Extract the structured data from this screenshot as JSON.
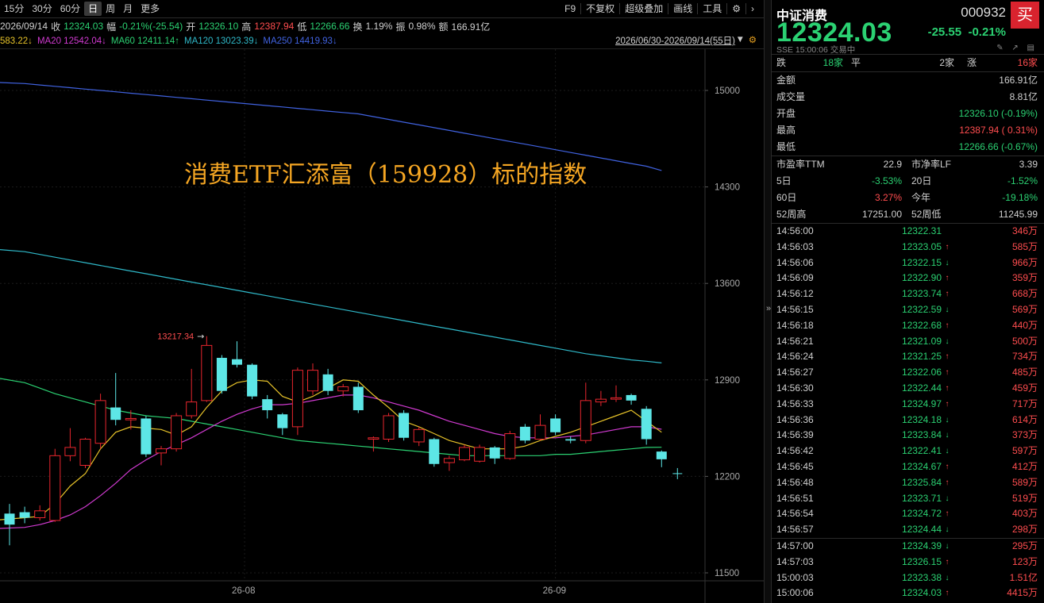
{
  "toolbar": {
    "periods": [
      "15分",
      "30分",
      "60分",
      "日",
      "周",
      "月",
      "更多"
    ],
    "active_period": "日",
    "tools": [
      "F9",
      "不复权",
      "超级叠加",
      "画线",
      "工具",
      "⚙",
      "›"
    ]
  },
  "info": {
    "date": "2026/09/14",
    "close_label": "收",
    "close": "12324.03",
    "amp_label": "幅",
    "amp": "-0.21%(-25.54)",
    "open_label": "开",
    "open": "12326.10",
    "high_label": "高",
    "high": "12387.94",
    "low_label": "低",
    "low": "12266.66",
    "turnover_label": "换",
    "turnover": "1.19%",
    "swing_label": "振",
    "swing": "0.98%",
    "amount_label": "额",
    "amount": "166.91亿"
  },
  "ma": {
    "ma_partial": "583.22↓",
    "ma20": "MA20 12542.04↓",
    "ma60": "MA60 12411.14↑",
    "ma120": "MA120 13023.39↓",
    "ma250": "MA250 14419.93↓",
    "range": "2026/06/30-2026/09/14(55日)",
    "colors": {
      "ma5": "#e6c229",
      "ma20": "#d03ad0",
      "ma60": "#2bd172",
      "ma120": "#2fb8c8",
      "ma250": "#4062e0"
    }
  },
  "chart_data": {
    "type": "candlestick",
    "title": "消费ETF汇添富（159928）标的指数",
    "y_ticks": [
      15000,
      14300,
      13600,
      12900,
      12200,
      11500
    ],
    "x_ticks": [
      "26-08",
      "26-09"
    ],
    "max_label": "13217.34",
    "candles": [
      {
        "o": 11930,
        "c": 11850,
        "h": 12000,
        "l": 11700
      },
      {
        "o": 11940,
        "c": 11900,
        "h": 11980,
        "l": 11860
      },
      {
        "o": 11900,
        "c": 11950,
        "h": 11990,
        "l": 11880
      },
      {
        "o": 11880,
        "c": 12350,
        "h": 12400,
        "l": 11870
      },
      {
        "o": 12350,
        "c": 12410,
        "h": 12550,
        "l": 12310
      },
      {
        "o": 12280,
        "c": 12470,
        "h": 12480,
        "l": 12260
      },
      {
        "o": 12440,
        "c": 12750,
        "h": 12800,
        "l": 12400
      },
      {
        "o": 12700,
        "c": 12610,
        "h": 12950,
        "l": 12570
      },
      {
        "o": 12610,
        "c": 12620,
        "h": 12680,
        "l": 12540
      },
      {
        "o": 12620,
        "c": 12360,
        "h": 12640,
        "l": 12340
      },
      {
        "o": 12370,
        "c": 12400,
        "h": 12420,
        "l": 12280
      },
      {
        "o": 12400,
        "c": 12640,
        "h": 12660,
        "l": 12380
      },
      {
        "o": 12640,
        "c": 12740,
        "h": 12980,
        "l": 12620
      },
      {
        "o": 12750,
        "c": 13150,
        "h": 13217.34,
        "l": 12740
      },
      {
        "o": 13060,
        "c": 12820,
        "h": 13080,
        "l": 12800
      },
      {
        "o": 13050,
        "c": 13010,
        "h": 13180,
        "l": 12990
      },
      {
        "o": 13010,
        "c": 12780,
        "h": 13020,
        "l": 12760
      },
      {
        "o": 12760,
        "c": 12680,
        "h": 12790,
        "l": 12620
      },
      {
        "o": 12650,
        "c": 12550,
        "h": 12660,
        "l": 12500
      },
      {
        "o": 12560,
        "c": 12970,
        "h": 12990,
        "l": 12500
      },
      {
        "o": 12820,
        "c": 12970,
        "h": 13020,
        "l": 12790
      },
      {
        "o": 12940,
        "c": 12820,
        "h": 12980,
        "l": 12790
      },
      {
        "o": 12820,
        "c": 12850,
        "h": 12870,
        "l": 12780
      },
      {
        "o": 12850,
        "c": 12680,
        "h": 12880,
        "l": 12660
      },
      {
        "o": 12470,
        "c": 12480,
        "h": 12490,
        "l": 12380
      },
      {
        "o": 12470,
        "c": 12640,
        "h": 12660,
        "l": 12450
      },
      {
        "o": 12660,
        "c": 12480,
        "h": 12680,
        "l": 12460
      },
      {
        "o": 12450,
        "c": 12540,
        "h": 12560,
        "l": 12420
      },
      {
        "o": 12470,
        "c": 12290,
        "h": 12480,
        "l": 12270
      },
      {
        "o": 12300,
        "c": 12330,
        "h": 12350,
        "l": 12240
      },
      {
        "o": 12320,
        "c": 12410,
        "h": 12430,
        "l": 12310
      },
      {
        "o": 12310,
        "c": 12410,
        "h": 12430,
        "l": 12300
      },
      {
        "o": 12410,
        "c": 12330,
        "h": 12420,
        "l": 12290
      },
      {
        "o": 12330,
        "c": 12510,
        "h": 12530,
        "l": 12320
      },
      {
        "o": 12560,
        "c": 12460,
        "h": 12580,
        "l": 12440
      },
      {
        "o": 12470,
        "c": 12570,
        "h": 12650,
        "l": 12460
      },
      {
        "o": 12620,
        "c": 12520,
        "h": 12650,
        "l": 12500
      },
      {
        "o": 12470,
        "c": 12460,
        "h": 12490,
        "l": 12440
      },
      {
        "o": 12460,
        "c": 12750,
        "h": 12880,
        "l": 12440
      },
      {
        "o": 12740,
        "c": 12760,
        "h": 12820,
        "l": 12710
      },
      {
        "o": 12760,
        "c": 12770,
        "h": 12860,
        "l": 12740
      },
      {
        "o": 12790,
        "c": 12750,
        "h": 12800,
        "l": 12720
      },
      {
        "o": 12690,
        "c": 12470,
        "h": 12710,
        "l": 12430
      },
      {
        "o": 12380,
        "c": 12324.03,
        "h": 12387.94,
        "l": 12266.66
      }
    ],
    "ma5": [
      11880,
      11900,
      11910,
      12000,
      12130,
      12220,
      12400,
      12520,
      12560,
      12550,
      12540,
      12500,
      12560,
      12700,
      12820,
      12880,
      12900,
      12890,
      12780,
      12740,
      12780,
      12840,
      12900,
      12890,
      12790,
      12700,
      12600,
      12560,
      12510,
      12460,
      12430,
      12400,
      12400,
      12400,
      12420,
      12460,
      12490,
      12520,
      12560,
      12600,
      12640,
      12680,
      12600,
      12520
    ],
    "ma20": [
      11820,
      11830,
      11850,
      11880,
      11920,
      11980,
      12060,
      12150,
      12250,
      12320,
      12380,
      12430,
      12480,
      12540,
      12600,
      12650,
      12690,
      12720,
      12720,
      12730,
      12750,
      12770,
      12790,
      12790,
      12770,
      12740,
      12710,
      12680,
      12640,
      12600,
      12570,
      12540,
      12510,
      12490,
      12480,
      12480,
      12480,
      12490,
      12500,
      12520,
      12540,
      12560,
      12560,
      12542
    ],
    "ma60": [
      12920,
      12880,
      12840,
      12800,
      12770,
      12740,
      12710,
      12680,
      12660,
      12640,
      12630,
      12620,
      12600,
      12580,
      12560,
      12540,
      12520,
      12500,
      12480,
      12460,
      12450,
      12440,
      12430,
      12420,
      12410,
      12400,
      12390,
      12380,
      12370,
      12360,
      12350,
      12350,
      12350,
      12350,
      12350,
      12350,
      12360,
      12360,
      12370,
      12380,
      12390,
      12400,
      12410,
      12411
    ],
    "ma120": [
      13850,
      13830,
      13810,
      13790,
      13770,
      13750,
      13730,
      13710,
      13690,
      13670,
      13650,
      13630,
      13610,
      13590,
      13570,
      13550,
      13530,
      13510,
      13490,
      13470,
      13450,
      13430,
      13410,
      13390,
      13370,
      13350,
      13330,
      13310,
      13290,
      13270,
      13250,
      13230,
      13210,
      13190,
      13170,
      13150,
      13130,
      13110,
      13090,
      13075,
      13060,
      13045,
      13035,
      13023
    ],
    "ma250": [
      15060,
      15050,
      15040,
      15030,
      15020,
      15010,
      15000,
      14990,
      14980,
      14970,
      14960,
      14950,
      14940,
      14930,
      14920,
      14910,
      14900,
      14890,
      14880,
      14870,
      14860,
      14850,
      14840,
      14830,
      14810,
      14790,
      14770,
      14750,
      14730,
      14710,
      14690,
      14670,
      14650,
      14630,
      14610,
      14590,
      14570,
      14550,
      14530,
      14510,
      14490,
      14470,
      14450,
      14419
    ]
  },
  "quote": {
    "name": "中证消费",
    "code": "000932",
    "buy": "买",
    "price": "12324.03",
    "change": "-25.55",
    "change_pct": "-0.21%",
    "sub": "SSE  15:00:06  交易中",
    "icons": "✎ ↗ ▤",
    "breadth": {
      "down_label": "跌",
      "down": "18家",
      "flat_label": "平",
      "flat": "2家",
      "up_label": "涨",
      "up": "16家"
    },
    "rows": [
      {
        "label": "金额",
        "value": "166.91亿",
        "cls": "w"
      },
      {
        "label": "成交量",
        "value": "8.81亿",
        "cls": "w"
      },
      {
        "label": "开盘",
        "value": "12326.10 (-0.19%)",
        "cls": "g"
      },
      {
        "label": "最高",
        "value": "12387.94 ( 0.31%)",
        "cls": "r"
      },
      {
        "label": "最低",
        "value": "12266.66 (-0.67%)",
        "cls": "g"
      }
    ],
    "stats": [
      {
        "l1": "市盈率TTM",
        "v1": "22.9",
        "c1": "w",
        "l2": "市净率LF",
        "v2": "3.39",
        "c2": "w"
      },
      {
        "l1": "5日",
        "v1": "-3.53%",
        "c1": "g",
        "l2": "20日",
        "v2": "-1.52%",
        "c2": "g"
      },
      {
        "l1": "60日",
        "v1": "3.27%",
        "c1": "r",
        "l2": "今年",
        "v2": "-19.18%",
        "c2": "g"
      },
      {
        "l1": "52周高",
        "v1": "17251.00",
        "c1": "w",
        "l2": "52周低",
        "v2": "11245.99",
        "c2": "w"
      }
    ]
  },
  "ticks": [
    {
      "t": "14:56:00",
      "p": "12322.31",
      "a": "",
      "v": "346万"
    },
    {
      "t": "14:56:03",
      "p": "12323.05",
      "a": "up",
      "v": "585万"
    },
    {
      "t": "14:56:06",
      "p": "12322.15",
      "a": "down",
      "v": "966万"
    },
    {
      "t": "14:56:09",
      "p": "12322.90",
      "a": "up",
      "v": "359万"
    },
    {
      "t": "14:56:12",
      "p": "12323.74",
      "a": "up",
      "v": "668万"
    },
    {
      "t": "14:56:15",
      "p": "12322.59",
      "a": "down",
      "v": "569万"
    },
    {
      "t": "14:56:18",
      "p": "12322.68",
      "a": "up",
      "v": "440万"
    },
    {
      "t": "14:56:21",
      "p": "12321.09",
      "a": "down",
      "v": "500万"
    },
    {
      "t": "14:56:24",
      "p": "12321.25",
      "a": "up",
      "v": "734万"
    },
    {
      "t": "14:56:27",
      "p": "12322.06",
      "a": "up",
      "v": "485万"
    },
    {
      "t": "14:56:30",
      "p": "12322.44",
      "a": "up",
      "v": "459万"
    },
    {
      "t": "14:56:33",
      "p": "12324.97",
      "a": "up",
      "v": "717万"
    },
    {
      "t": "14:56:36",
      "p": "12324.18",
      "a": "down",
      "v": "614万"
    },
    {
      "t": "14:56:39",
      "p": "12323.84",
      "a": "down",
      "v": "373万"
    },
    {
      "t": "14:56:42",
      "p": "12322.41",
      "a": "down",
      "v": "597万"
    },
    {
      "t": "14:56:45",
      "p": "12324.67",
      "a": "up",
      "v": "412万"
    },
    {
      "t": "14:56:48",
      "p": "12325.84",
      "a": "up",
      "v": "589万"
    },
    {
      "t": "14:56:51",
      "p": "12323.71",
      "a": "down",
      "v": "519万"
    },
    {
      "t": "14:56:54",
      "p": "12324.72",
      "a": "up",
      "v": "403万"
    },
    {
      "t": "14:56:57",
      "p": "12324.44",
      "a": "down",
      "v": "298万"
    },
    {
      "t": "14:57:00",
      "p": "12324.39",
      "a": "down",
      "v": "295万"
    },
    {
      "t": "14:57:03",
      "p": "12326.15",
      "a": "up",
      "v": "123万"
    },
    {
      "t": "15:00:03",
      "p": "12323.38",
      "a": "down",
      "v": "1.51亿"
    },
    {
      "t": "15:00:06",
      "p": "12324.03",
      "a": "up",
      "v": "4415万"
    }
  ]
}
